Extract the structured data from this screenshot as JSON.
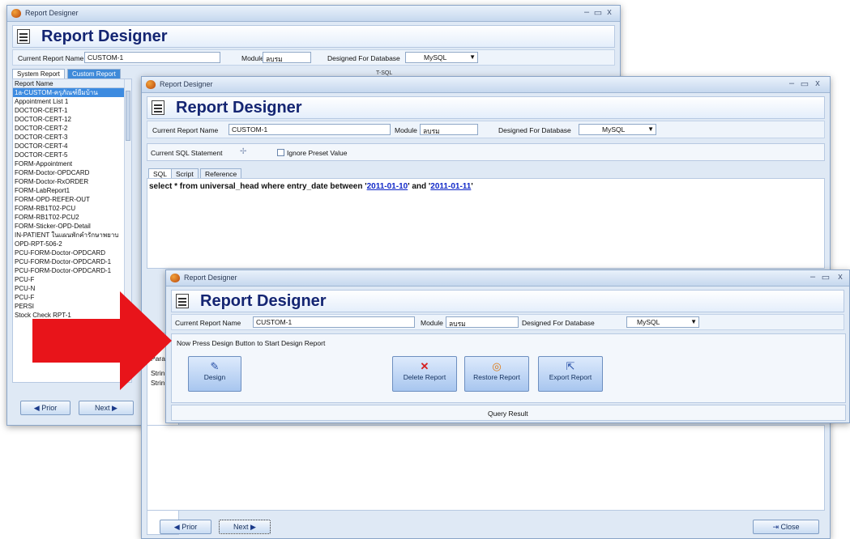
{
  "win1": {
    "title": "Report Designer",
    "header": "Report Designer",
    "current_report_label": "Current Report Name",
    "current_report_value": "CUSTOM-1",
    "module_label": "Module",
    "module_value": "ลบรม",
    "db_label": "Designed For Database",
    "db_value": "MySQL",
    "tab_system": "System Report",
    "tab_custom": "Custom Report",
    "tsql_label": "T-SQL",
    "list_header": "Report Name",
    "reports": [
      "1a-CUSTOM-ครุภัณฑ์ยืมบ้าน",
      "Appointment List 1",
      "DOCTOR-CERT-1",
      "DOCTOR-CERT-12",
      "DOCTOR-CERT-2",
      "DOCTOR-CERT-3",
      "DOCTOR-CERT-4",
      "DOCTOR-CERT-5",
      "FORM-Appointment",
      "FORM-Doctor-OPDCARD",
      "FORM-Doctor-RxORDER",
      "FORM-LabReport1",
      "FORM-OPD-REFER-OUT",
      "FORM-RB1T02-PCU",
      "FORM-RB1T02-PCU2",
      "FORM-Sticker-OPD-Detail",
      "IN-PATIENT ในแผนพักคำรักษาพยาบ",
      "OPD-RPT-506-2",
      "PCU-FORM-Doctor-OPDCARD",
      "PCU-FORM-Doctor-OPDCARD-1",
      "PCU-FORM-Doctor-OPDCARD-1",
      "PCU-F",
      "PCU-N",
      "PCU-F",
      "PERSI",
      "Stock Check RPT-1"
    ],
    "prior_label": "Prior",
    "next_label": "Next"
  },
  "win2": {
    "title": "Report Designer",
    "header": "Report Designer",
    "current_report_label": "Current Report Name",
    "current_report_value": "CUSTOM-1",
    "module_label": "Module",
    "module_value": "ลบรม",
    "db_label": "Designed For Database",
    "db_value": "MySQL",
    "sql_statement_label": "Current SQL Statement",
    "ignore_preset_label": "Ignore Preset Value",
    "tabs": [
      "SQL",
      "Script",
      "Reference"
    ],
    "sql_prefix": "select * from universal_head where entry_date between '",
    "sql_date1": "2011-01-10",
    "sql_middle": "' and '",
    "sql_date2": "2011-01-11",
    "sql_suffix": "'",
    "param_header": "Para",
    "param_row1": "Strin",
    "param_row2": "Strin",
    "ne_label": "Ne",
    "prior_label": "Prior",
    "next_label": "Next",
    "close_label": "Close"
  },
  "win3": {
    "title": "Report Designer",
    "header": "Report Designer",
    "current_report_label": "Current Report Name",
    "current_report_value": "CUSTOM-1",
    "module_label": "Module",
    "module_value": "ลบรม",
    "db_label": "Designed For Database",
    "db_value": "MySQL",
    "hint": "Now Press Design Button to Start Design Report",
    "design_label": "Design",
    "delete_label": "Delete Report",
    "restore_label": "Restore Report",
    "export_label": "Export Report",
    "query_result_label": "Query Result"
  },
  "colors": {
    "header_text": "#142572",
    "selected_row": "#3d8be0",
    "arrow": "#e8141a",
    "link": "#1028c8"
  }
}
